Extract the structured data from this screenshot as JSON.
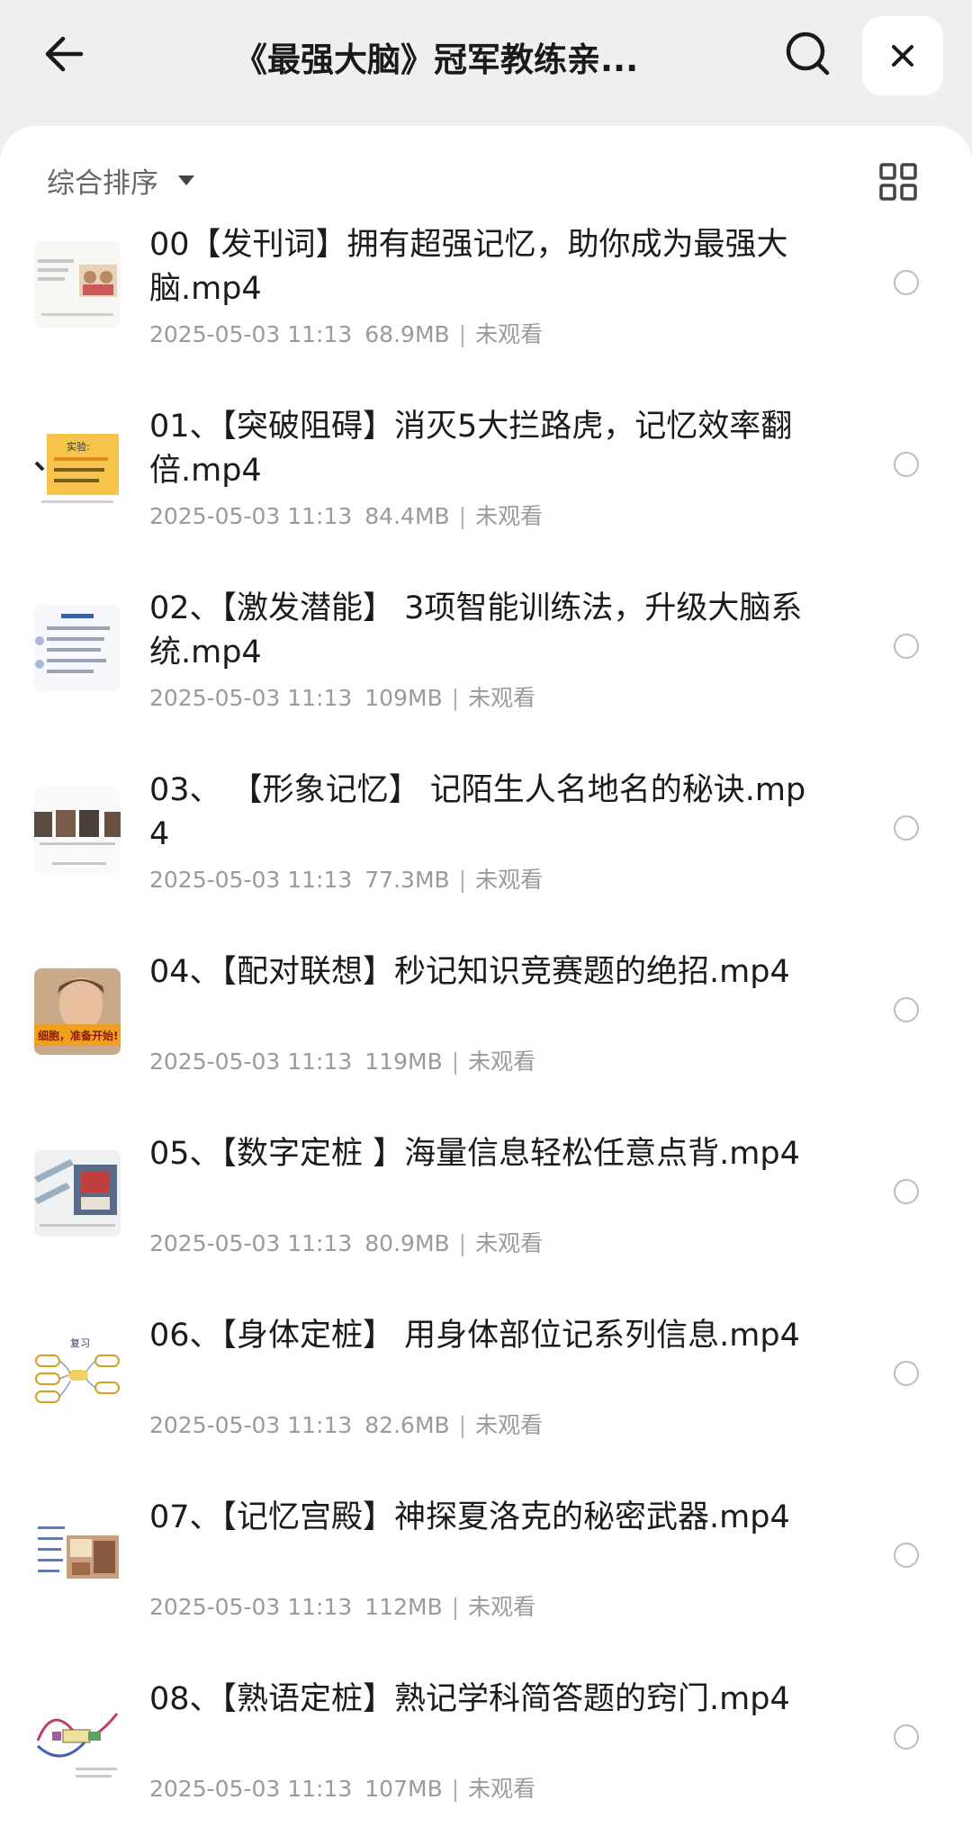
{
  "header": {
    "title": "《最强大脑》冠军教练亲...",
    "back_icon": "arrow-left-icon",
    "search_icon": "search-icon",
    "close_icon": "close-icon"
  },
  "toolbar": {
    "sort_label": "综合排序",
    "grid_icon": "grid-view-icon"
  },
  "files": [
    {
      "name": "00【发刊词】拥有超强记忆，助你成为最强大脑.mp4",
      "date": "2025-05-03 11:13",
      "size": "68.9MB",
      "status": "未观看"
    },
    {
      "name": "01、【突破阻碍】消灭5大拦路虎，记忆效率翻倍.mp4",
      "date": "2025-05-03 11:13",
      "size": "84.4MB",
      "status": "未观看"
    },
    {
      "name": "02、【激发潜能】 3项智能训练法，升级大脑系统.mp4",
      "date": "2025-05-03 11:13",
      "size": "109MB",
      "status": "未观看"
    },
    {
      "name": "03、 【形象记忆】 记陌生人名地名的秘诀.mp4",
      "date": "2025-05-03 11:13",
      "size": "77.3MB",
      "status": "未观看"
    },
    {
      "name": "04、【配对联想】秒记知识竞赛题的绝招.mp4",
      "date": "2025-05-03 11:13",
      "size": "119MB",
      "status": "未观看"
    },
    {
      "name": "05、【数字定桩 】海量信息轻松任意点背.mp4",
      "date": "2025-05-03 11:13",
      "size": "80.9MB",
      "status": "未观看"
    },
    {
      "name": "06、【身体定桩】 用身体部位记系列信息.mp4",
      "date": "2025-05-03 11:13",
      "size": "82.6MB",
      "status": "未观看"
    },
    {
      "name": "07、【记忆宫殿】神探夏洛克的秘密武器.mp4",
      "date": "2025-05-03 11:13",
      "size": "112MB",
      "status": "未观看"
    },
    {
      "name": "08、【熟语定桩】熟记学科简答题的窍门.mp4",
      "date": "2025-05-03 11:13",
      "size": "107MB",
      "status": "未观看"
    }
  ],
  "thumb_text": {
    "t1": "实验:",
    "t4": "细胞，准备开始!",
    "t6": "复习"
  },
  "colors": {
    "background": "#efeff1",
    "card": "#ffffff",
    "title_text": "#1b1b1b",
    "meta_text": "#9a9a9a",
    "radio_border": "#bdbdbd"
  }
}
